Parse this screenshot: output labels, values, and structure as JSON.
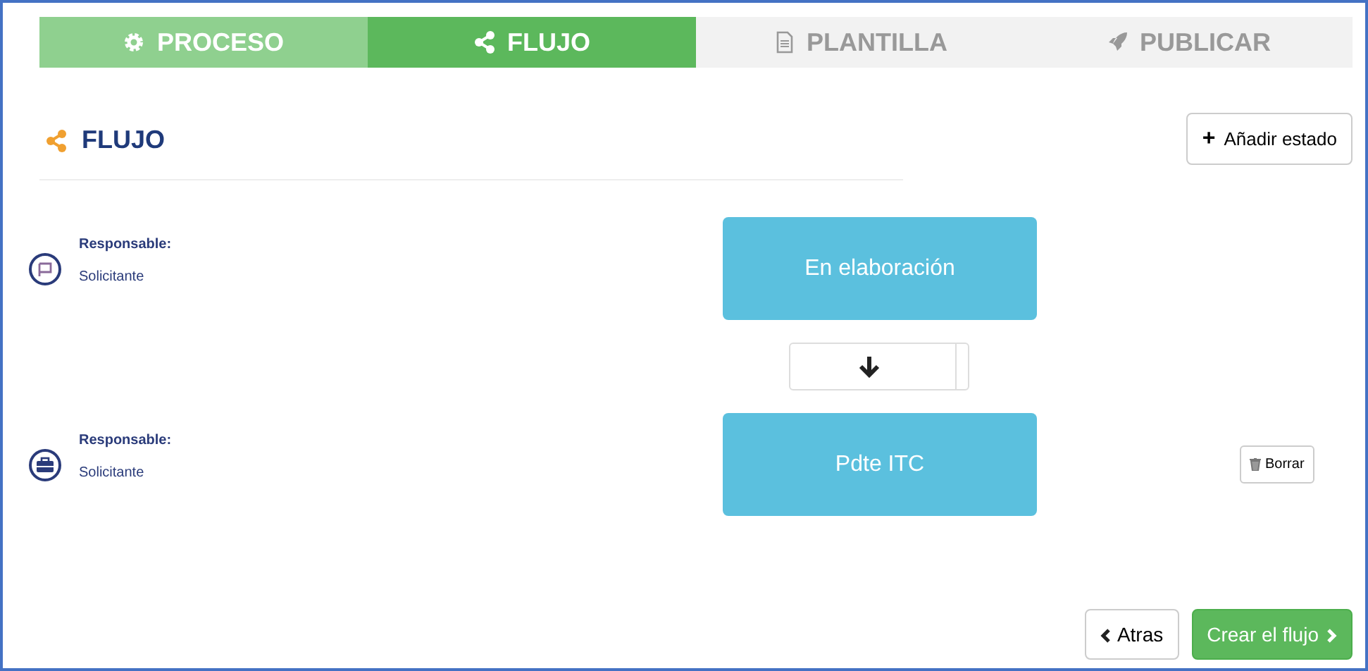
{
  "steps": [
    {
      "label": "PROCESO",
      "completed": true,
      "selected": false
    },
    {
      "label": "FLUJO",
      "completed": false,
      "selected": true
    },
    {
      "label": "PLANTILLA",
      "completed": false,
      "selected": false
    },
    {
      "label": "PUBLICAR",
      "completed": false,
      "selected": false
    }
  ],
  "heading": {
    "title": "FLUJO"
  },
  "add_button": {
    "icon": "+",
    "label": "Añadir estado"
  },
  "states": [
    {
      "responsible_label": "Responsable:",
      "responsible": "Solicitante",
      "name": "En elaboración"
    },
    {
      "responsible_label": "Responsable:",
      "responsible": "Solicitante",
      "name": "Pdte ITC",
      "delete_label": "Borrar"
    }
  ],
  "footer": {
    "back": "Atras",
    "create": "Crear el flujo"
  }
}
